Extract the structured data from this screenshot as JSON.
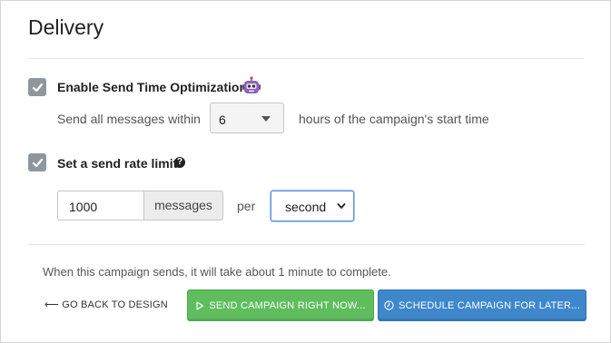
{
  "section": {
    "title": "Delivery"
  },
  "send_time_optimization": {
    "label": "Enable Send Time Optimization",
    "checked": true,
    "prefix_text": "Send all messages within",
    "hours_value": "6",
    "suffix_text": "hours of the campaign's start time",
    "icon": "robot-icon"
  },
  "send_rate_limit": {
    "label": "Set a send rate limit",
    "checked": true,
    "help_icon": "question-circle-icon",
    "help_glyph": "?",
    "amount_value": "1000",
    "amount_unit": "messages",
    "per_text": "per",
    "interval_value": "second"
  },
  "summary_text": "When this campaign sends, it will take about 1 minute to complete.",
  "actions": {
    "back_label": "⟵ GO BACK TO DESIGN",
    "send_now_label": "SEND CAMPAIGN RIGHT NOW...",
    "schedule_label": "SCHEDULE CAMPAIGN FOR LATER..."
  },
  "colors": {
    "send_button": "#5fbd5e",
    "schedule_button": "#3f87cb",
    "checkbox": "#8f979e",
    "focus": "#5b8fd6"
  }
}
